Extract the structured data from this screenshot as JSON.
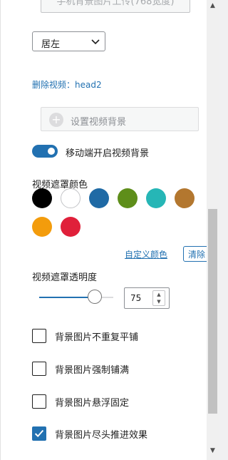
{
  "upload": {
    "label": "手机背景图片上传(768宽度)"
  },
  "align": {
    "selected": "居左"
  },
  "video": {
    "delete_link": "删除视频：head2"
  },
  "background": {
    "set_button": "设置视频背景"
  },
  "mobile_toggle": {
    "label": "移动端开启视频背景",
    "on": true
  },
  "overlay_color": {
    "label": "视频遮罩颜色",
    "swatches": [
      "#000000",
      "#ffffff",
      "#1f6aa5",
      "#5e8e1a",
      "#26b6b6",
      "#b3772f",
      "#f39c0c",
      "#e0203a"
    ],
    "custom_link": "自定义颜色",
    "clear_button": "清除"
  },
  "overlay_opacity": {
    "label": "视频遮罩透明度",
    "value": "75"
  },
  "options": [
    {
      "label": "背景图片不重复平铺",
      "checked": false
    },
    {
      "label": "背景图片强制铺满",
      "checked": false
    },
    {
      "label": "背景图片悬浮固定",
      "checked": false
    },
    {
      "label": "背景图片尽头推进效果",
      "checked": true
    }
  ]
}
